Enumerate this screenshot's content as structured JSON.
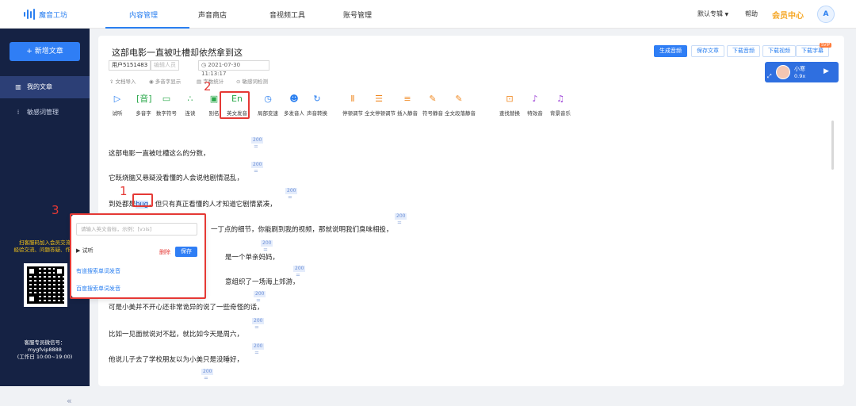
{
  "app": {
    "logo_text": "魔音工坊"
  },
  "nav": {
    "tabs": [
      "内容管理",
      "声音商店",
      "音视频工具",
      "账号管理"
    ],
    "active": "内容管理"
  },
  "topbar": {
    "album": "默认专辑",
    "album_arrow": "▼",
    "help": "帮助",
    "vip": "会员中心",
    "avatar_text": "A"
  },
  "sidebar": {
    "new_button": "+ 新增文章",
    "items": [
      {
        "label": "我的文章",
        "icon": "book-icon"
      },
      {
        "label": "敏感词管理",
        "icon": "filter-icon"
      }
    ],
    "promo": [
      "扫客服码加入会员交流",
      "经验交流、问题答疑、作品"
    ],
    "service": [
      "客服专员微信号：",
      "mygfvip8888",
      "(工作日 10:00~19:00)"
    ],
    "collapse": "«"
  },
  "document": {
    "title": "这部电影一直被吐槽却依然拿到这",
    "user": "用户5151483",
    "editor_placeholder": "编辑人员",
    "datetime": "2021-07-30 11:13:17",
    "meta": [
      "文档导入",
      "多音字显示",
      "字数统计",
      "敏感词检测"
    ]
  },
  "actions": {
    "generate": "生成音频",
    "save": "保存文章",
    "download_audio": "下载音频",
    "download_video": "下载视频",
    "download_subtitle": "下载字幕",
    "svip": "SVIP"
  },
  "player": {
    "name": "小寒",
    "speed": "0.9x",
    "play_icon": "▶",
    "expand_icon": "⤢"
  },
  "tools": [
    {
      "label": "试听",
      "icon": "▷",
      "color": "#2a7ff0"
    },
    {
      "label": "多音字",
      "icon": "[音]",
      "color": "#2aa84a"
    },
    {
      "label": "数字符号",
      "icon": "▭",
      "color": "#2aa84a"
    },
    {
      "label": "连读",
      "icon": "∴",
      "color": "#2aa84a"
    },
    {
      "label": "别名",
      "icon": "▣",
      "color": "#2aa84a"
    },
    {
      "label": "英文发音",
      "icon": "En",
      "color": "#2aa84a"
    },
    {
      "label": "局部变速",
      "icon": "◷",
      "color": "#2a7ff0"
    },
    {
      "label": "多发音人",
      "icon": "☻",
      "color": "#2a7ff0"
    },
    {
      "label": "声音转换",
      "icon": "↻",
      "color": "#2a7ff0"
    },
    {
      "label": "停顿调节",
      "icon": "Ⅱ",
      "color": "#f08a24"
    },
    {
      "label": "全文停顿调节",
      "icon": "☰",
      "color": "#f08a24"
    },
    {
      "label": "插入静音",
      "icon": "≡",
      "color": "#f08a24"
    },
    {
      "label": "符号静音",
      "icon": "✎",
      "color": "#f08a24"
    },
    {
      "label": "全文段落静音",
      "icon": "✎",
      "color": "#f08a24"
    },
    {
      "label": "查找替换",
      "icon": "⊡",
      "color": "#f08a24"
    },
    {
      "label": "特效音",
      "icon": "♪",
      "color": "#9b3fd6"
    },
    {
      "label": "背景音乐",
      "icon": "♫",
      "color": "#9b3fd6"
    }
  ],
  "paragraphs": [
    {
      "text": "这部电影一直被吐槽这么的分数，",
      "badge": "200"
    },
    {
      "text": "它既烧脑又悬疑没看懂的人会说他剧情混乱，",
      "badge": "200"
    },
    {
      "pre": "到处都是",
      "word": "bug",
      "post": "，但只有真正看懂的人才知道它剧情紧凑，",
      "badge": "200"
    },
    {
      "text": "一丁点的细节，你能刷到我的视频，那就说明我们臭味相投，",
      "badge": "200"
    },
    {
      "text": "是一个单亲妈妈，",
      "badge": "200"
    },
    {
      "text": "意组织了一场海上郊游，",
      "badge": "200"
    },
    {
      "text": "可是小美并不开心还非常诡异的说了一些奇怪的话，",
      "badge": "200"
    },
    {
      "text": "比如一见面就说对不起，就比如今天是周六，",
      "badge": "200"
    },
    {
      "text": "他说儿子去了学校朋友以为小美只是没睡好，",
      "badge": "200"
    },
    {
      "text": "",
      "badge": "200"
    }
  ],
  "popup": {
    "placeholder": "请输入英文音标，示例：[vɔis]",
    "listen": "试听",
    "delete": "删除",
    "save": "保存",
    "links": [
      "有道搜索单词发音",
      "百度搜索单词发音"
    ]
  },
  "annotations": [
    "1",
    "2",
    "3"
  ]
}
